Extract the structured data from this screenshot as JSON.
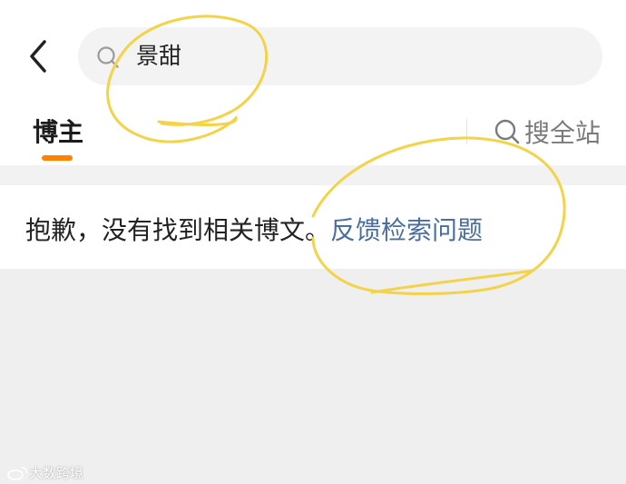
{
  "search": {
    "query": "景甜"
  },
  "tabs": {
    "active_label": "博主"
  },
  "site_search": {
    "label": "搜全站"
  },
  "message": {
    "text": "抱歉，没有找到相关博文。",
    "link": "反馈检索问题"
  },
  "watermark": {
    "text": "大数跨境"
  },
  "icons": {
    "back": "chevron-left-icon",
    "search": "search-icon",
    "site_search": "search-icon"
  },
  "colors": {
    "accent": "#ff8200",
    "link": "#4a6f9e",
    "highlight": "#f2d34a"
  }
}
